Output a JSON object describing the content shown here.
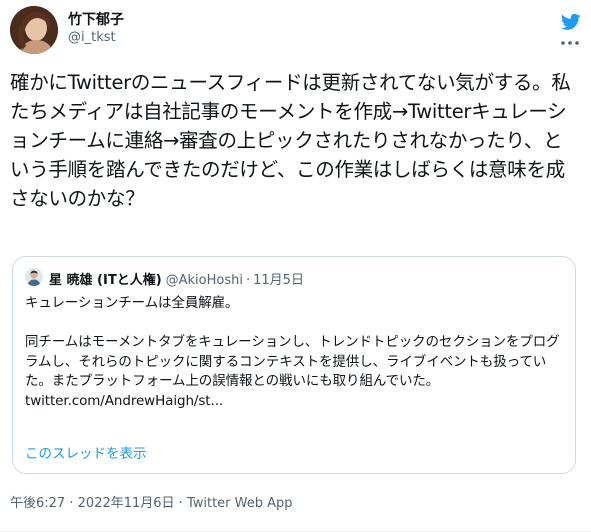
{
  "author": {
    "display_name": "竹下郁子",
    "handle": "@i_tkst"
  },
  "tweet": {
    "text": "確かにTwitterのニュースフィードは更新されてない気がする。私たちメディアは自社記事のモーメントを作成→Twitterキュレーションチームに連絡→審査の上ピックされたりされなかったり、という手順を踏んできたのだけど、この作業はしばらくは意味を成さないのかな？"
  },
  "quoted_tweet": {
    "display_name": "星 暁雄 (ITと人権)",
    "handle": "@AkioHoshi",
    "separator": "·",
    "date": "11月5日",
    "line1": "キュレーションチームは全員解雇。",
    "line2": "同チームはモーメントタブをキュレーションし、トレンドトピックのセクションをプログラムし、それらのトピックに関するコンテキストを提供し、ライブイベントも扱っていた。またプラットフォーム上の誤情報との戦いにも取り組んでいた。",
    "link": "twitter.com/AndrewHaigh/st...",
    "thread_link": "このスレッドを表示"
  },
  "meta": {
    "time": "午後6:27",
    "sep1": "·",
    "date": "2022年11月6日",
    "sep2": "·",
    "source": "Twitter Web App"
  },
  "colors": {
    "accent": "#1d9bf0",
    "text": "#0f1419",
    "secondary": "#536471",
    "border": "#cfd9de"
  },
  "icons": {
    "logo": "twitter-bird-icon",
    "more": "more-dots-icon"
  }
}
